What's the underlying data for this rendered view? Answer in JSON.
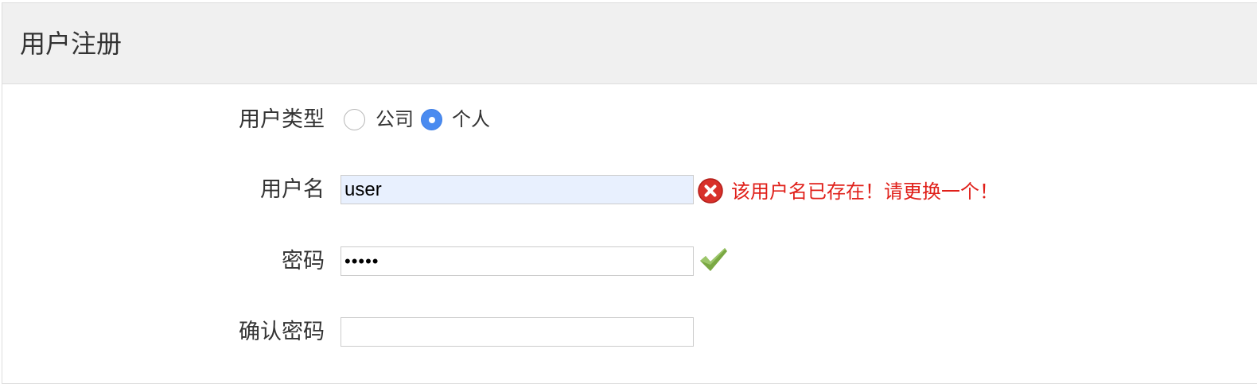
{
  "panel": {
    "title": "用户注册"
  },
  "form": {
    "user_type": {
      "label": "用户类型",
      "options": [
        {
          "label": "公司",
          "checked": false
        },
        {
          "label": "个人",
          "checked": true
        }
      ]
    },
    "username": {
      "label": "用户名",
      "value": "user",
      "error_icon": "error-x-icon",
      "error_message": "该用户名已存在！请更换一个！",
      "error_color": "#e0201a"
    },
    "password": {
      "label": "密码",
      "value": "•••••",
      "status_icon": "checkmark-icon",
      "status_color": "#7aa843"
    },
    "confirm_password": {
      "label": "确认密码",
      "value": ""
    }
  },
  "colors": {
    "header_bg": "#f0f0f0",
    "radio_accent": "#4a8bf0",
    "autofill_bg": "#e8f0fe"
  }
}
